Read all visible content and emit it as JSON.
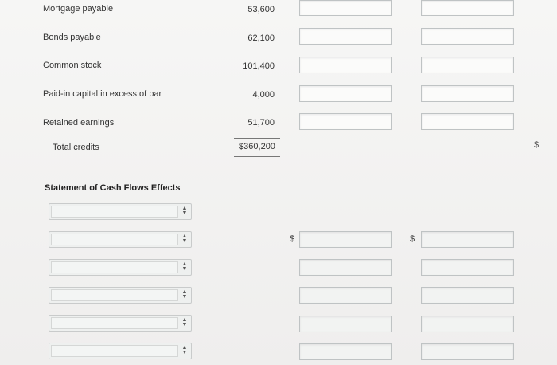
{
  "balance_sheet": {
    "rows": [
      {
        "label": "Mortgage payable",
        "amount": "53,600"
      },
      {
        "label": "Bonds payable",
        "amount": "62,100"
      },
      {
        "label": "Common stock",
        "amount": "101,400"
      },
      {
        "label": "Paid-in capital in excess of par",
        "amount": "4,000"
      },
      {
        "label": "Retained earnings",
        "amount": "51,700"
      }
    ],
    "total_label": "Total credits",
    "total_amount": "$360,200",
    "edge_symbol": "$"
  },
  "cash_flows": {
    "heading": "Statement of Cash Flows Effects",
    "currency_symbol_1": "$",
    "currency_symbol_2": "$"
  }
}
